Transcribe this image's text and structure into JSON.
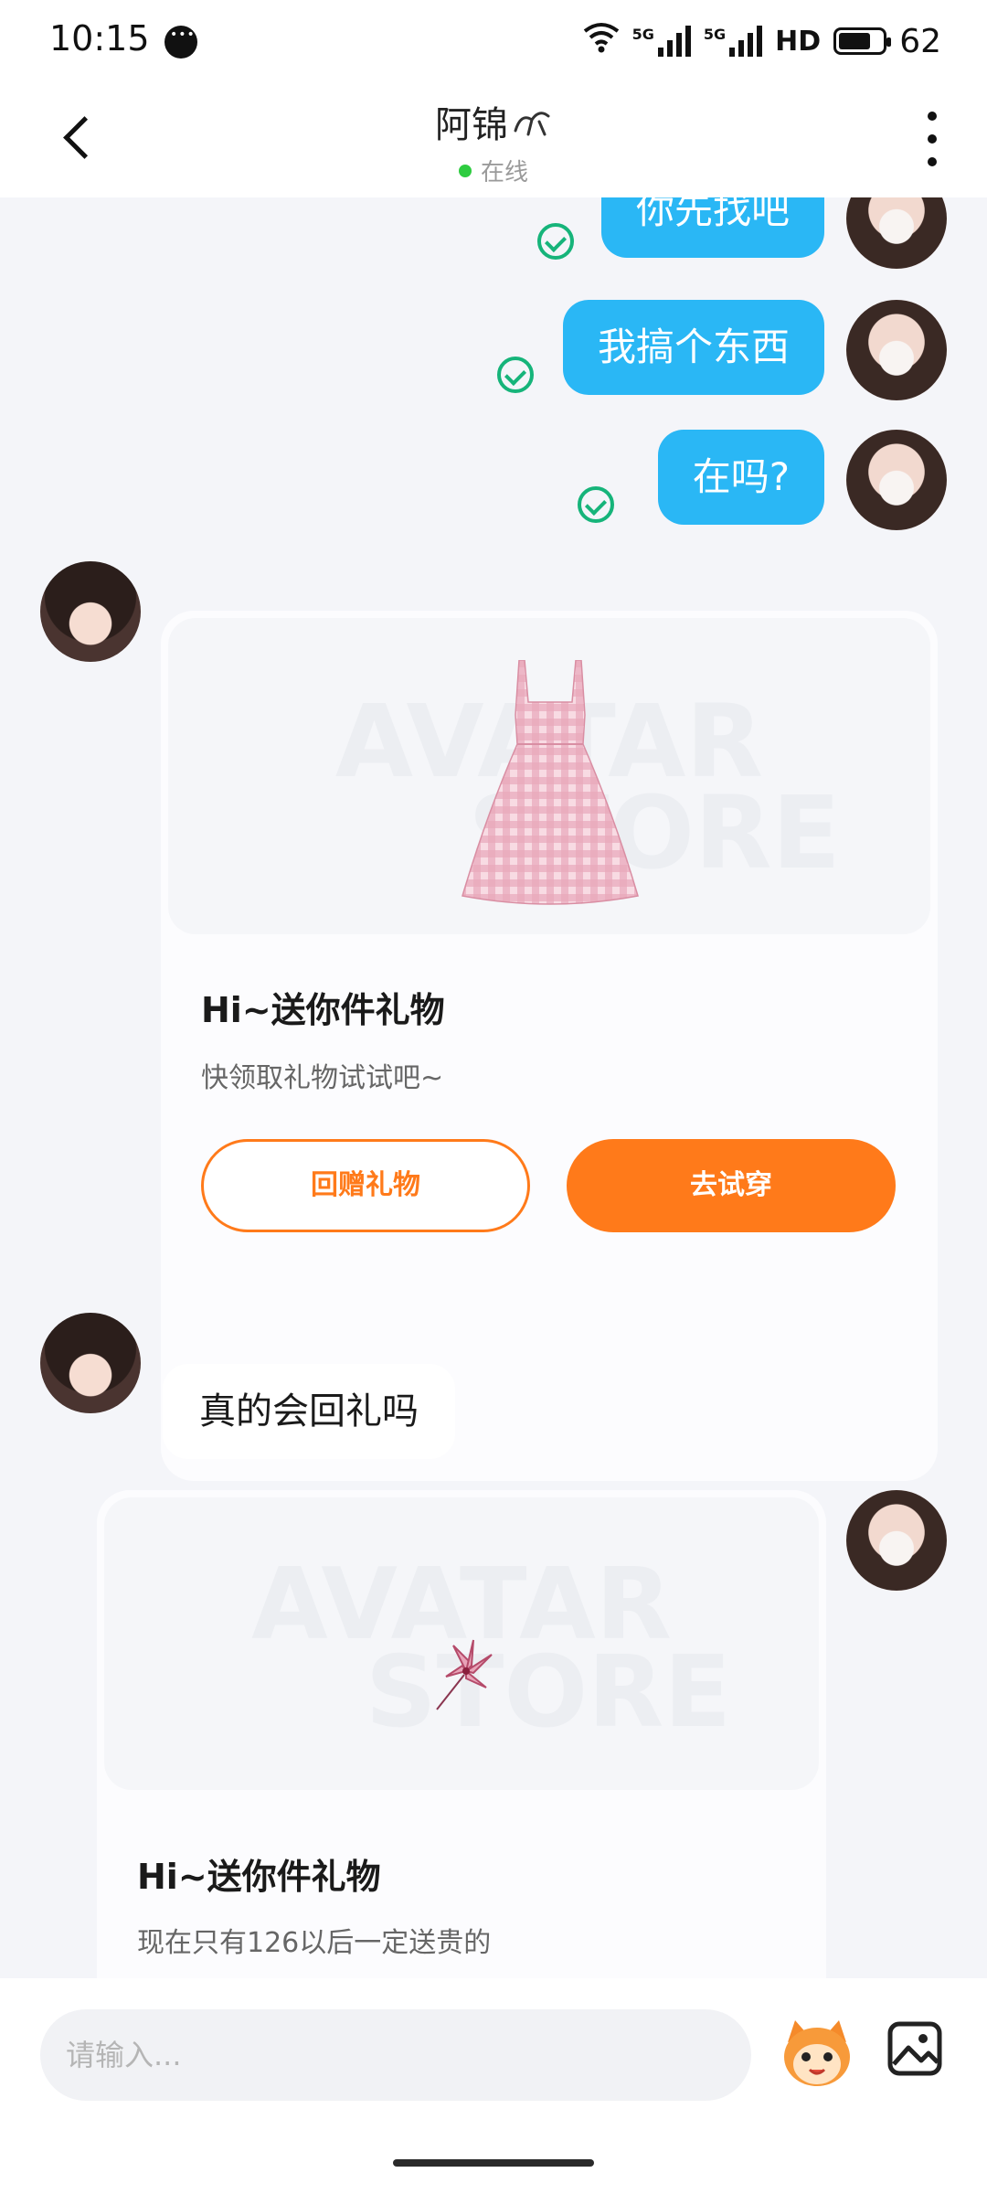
{
  "status_bar": {
    "time": "10:15",
    "network_1": "5G",
    "network_2": "5G",
    "hd": "HD",
    "battery": "62"
  },
  "header": {
    "title": "阿锦",
    "status": "在线",
    "back_icon": "chevron-left-icon",
    "more_icon": "more-vertical-icon"
  },
  "messages": {
    "out_1": "你先找吧",
    "out_2": "我搞个东西",
    "out_3": "在吗?",
    "gift_1": {
      "watermark_1": "AVATAR",
      "watermark_2": "STORE",
      "title": "Hi~送你件礼物",
      "subtitle": "快领取礼物试试吧~",
      "return_gift": "回赠礼物",
      "try_on": "去试穿"
    },
    "in_1": "真的会回礼吗",
    "gift_2": {
      "watermark_1": "AVATAR",
      "watermark_2": "STORE",
      "title": "Hi~送你件礼物",
      "subtitle": "现在只有126以后一定送贵的"
    }
  },
  "input_bar": {
    "placeholder": "请输入...",
    "emoji_icon": "emoji-mascot-icon",
    "image_icon": "image-icon"
  },
  "colors": {
    "outgoing_bubble": "#2ab7f5",
    "accent_orange": "#ff7a1a",
    "read_check": "#16b47a",
    "online": "#2ecc40",
    "chat_bg": "#f4f5f9"
  }
}
